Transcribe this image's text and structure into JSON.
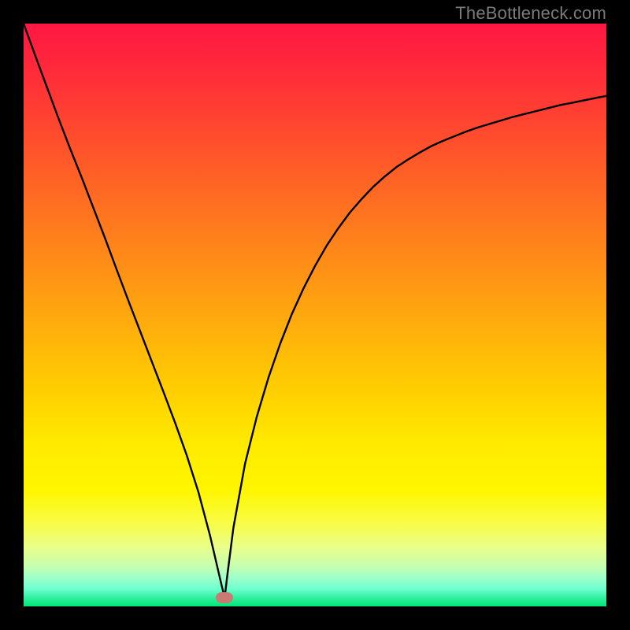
{
  "watermark": "TheBottleneck.com",
  "chart_data": {
    "type": "line",
    "title": "",
    "xlabel": "",
    "ylabel": "",
    "xlim": [
      0,
      1
    ],
    "ylim": [
      0,
      1
    ],
    "marker": {
      "x": 0.345,
      "y": 0.015
    },
    "series": [
      {
        "name": "curve",
        "x": [
          0.0,
          0.02,
          0.04,
          0.06,
          0.08,
          0.1,
          0.12,
          0.14,
          0.16,
          0.18,
          0.2,
          0.22,
          0.24,
          0.26,
          0.28,
          0.3,
          0.32,
          0.33,
          0.34,
          0.345,
          0.35,
          0.36,
          0.38,
          0.4,
          0.42,
          0.44,
          0.46,
          0.48,
          0.5,
          0.52,
          0.54,
          0.56,
          0.58,
          0.6,
          0.62,
          0.64,
          0.66,
          0.68,
          0.7,
          0.72,
          0.74,
          0.76,
          0.78,
          0.8,
          0.82,
          0.84,
          0.86,
          0.88,
          0.9,
          0.92,
          0.94,
          0.96,
          0.98,
          1.0
        ],
        "y": [
          1.0,
          0.945,
          0.891,
          0.837,
          0.785,
          0.735,
          0.683,
          0.631,
          0.577,
          0.524,
          0.472,
          0.42,
          0.368,
          0.315,
          0.259,
          0.196,
          0.121,
          0.078,
          0.035,
          0.015,
          0.057,
          0.135,
          0.245,
          0.325,
          0.392,
          0.45,
          0.501,
          0.545,
          0.584,
          0.619,
          0.649,
          0.676,
          0.699,
          0.72,
          0.738,
          0.754,
          0.767,
          0.779,
          0.79,
          0.799,
          0.807,
          0.815,
          0.822,
          0.828,
          0.834,
          0.84,
          0.845,
          0.85,
          0.855,
          0.86,
          0.864,
          0.868,
          0.872,
          0.876
        ]
      }
    ]
  }
}
